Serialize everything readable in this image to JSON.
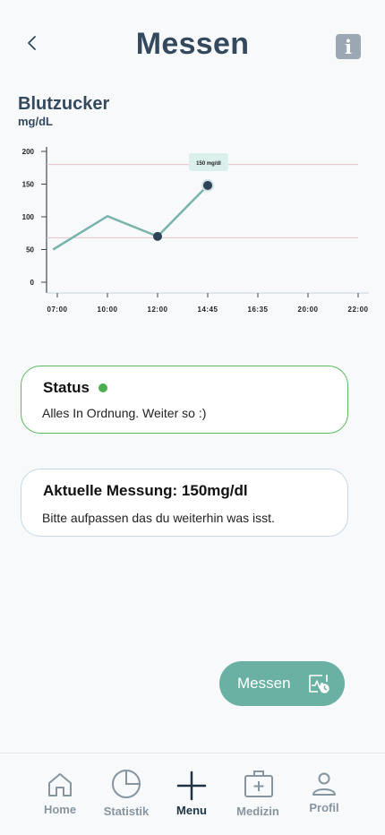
{
  "header": {
    "title": "Messen",
    "info_label": "i"
  },
  "chart_data": {
    "type": "line",
    "title": "Blutzucker",
    "unit": "mg/dL",
    "x_ticks": [
      "07:00",
      "10:00",
      "12:00",
      "14:45",
      "16:35",
      "20:00",
      "22:00"
    ],
    "y_ticks": [
      200,
      150,
      100,
      50,
      0
    ],
    "ylim": [
      0,
      200
    ],
    "reference_lines": [
      180,
      68
    ],
    "series": [
      {
        "points": [
          {
            "x": "06:45",
            "y": 50
          },
          {
            "x": "10:00",
            "y": 101
          },
          {
            "x": "12:00",
            "y": 70
          },
          {
            "x": "14:45",
            "y": 148
          }
        ]
      }
    ],
    "highlighted_points": [
      2,
      3
    ],
    "tooltip": "150 mg/dl",
    "colors": {
      "line": "#78b4ac",
      "point": "#2e4356",
      "reference": "#e9c3c7",
      "tooltip_bg": "#dbf0ec"
    }
  },
  "status_card": {
    "title": "Status",
    "text": "Alles In Ordnung. Weiter so :)",
    "color": "#5cb85c"
  },
  "measure_card": {
    "title": "Aktuelle Messung: 150mg/dl",
    "text": "Bitte aufpassen das du weiterhin was isst."
  },
  "measure_button": {
    "label": "Messen",
    "icon": "chart-measure-icon",
    "color": "#6ab1a4"
  },
  "tabbar": {
    "items": [
      {
        "label": "Home",
        "icon": "home-icon"
      },
      {
        "label": "Statistik",
        "icon": "pie-chart-icon"
      },
      {
        "label": "Menu",
        "icon": "plus-icon",
        "active": true
      },
      {
        "label": "Medizin",
        "icon": "medical-kit-icon"
      },
      {
        "label": "Profil",
        "icon": "user-icon"
      }
    ]
  }
}
